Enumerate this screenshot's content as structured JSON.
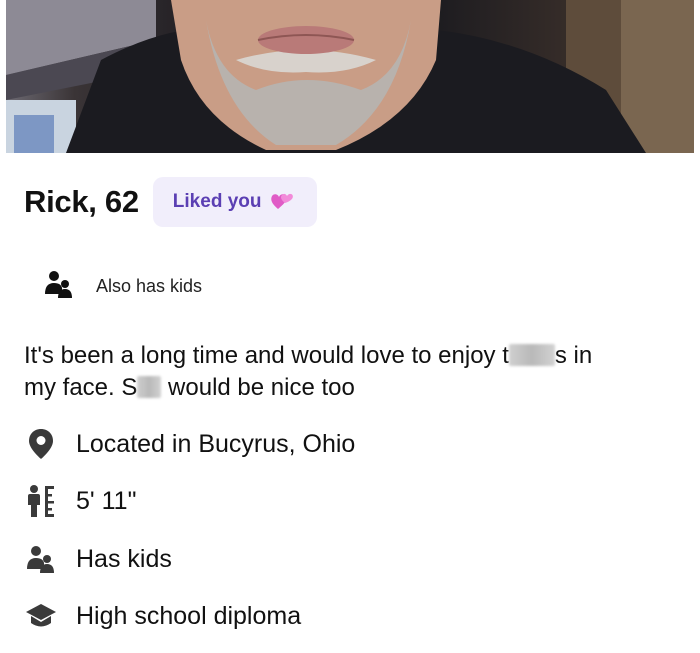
{
  "profile": {
    "name_age": "Rick, 62",
    "liked_badge": "Liked you",
    "kids_label": "Also has kids",
    "bio": {
      "line1_a": "It's been a long time and would love to enjoy t",
      "line1_b": "s in",
      "line2_a": "my face. S",
      "line2_b": " would be nice too"
    },
    "details": [
      {
        "icon": "location-pin-icon",
        "text": "Located in Bucyrus, Ohio"
      },
      {
        "icon": "height-icon",
        "text": "5' 11\""
      },
      {
        "icon": "kids-icon",
        "text": "Has kids"
      },
      {
        "icon": "graduation-cap-icon",
        "text": "High school diploma"
      }
    ]
  },
  "colors": {
    "badge_bg": "#f1eefb",
    "badge_text": "#5b3fb3",
    "icon": "#3a3a3a"
  }
}
